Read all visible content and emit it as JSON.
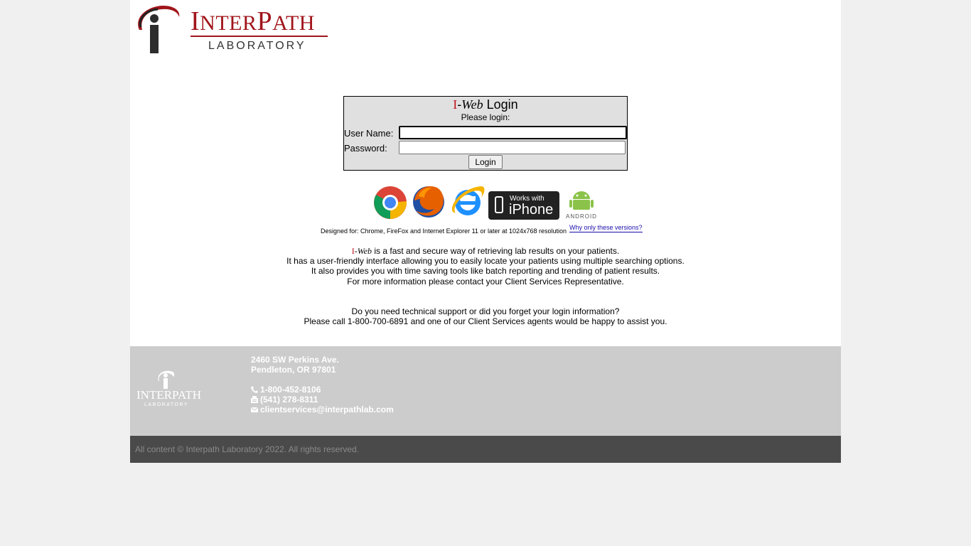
{
  "brand": {
    "name_first": "I",
    "name_rest": "NTER",
    "name_second_first": "P",
    "name_second_rest": "ATH",
    "subtitle": "LABORATORY",
    "colors": {
      "red": "#a0151b",
      "dark": "#333333"
    }
  },
  "login": {
    "title_i": "I",
    "title_dash": "-",
    "title_web": "Web",
    "title_login": " Login",
    "please": "Please login:",
    "username_label": "User Name:",
    "username_value": "",
    "password_label": "Password:",
    "password_value": "",
    "button_label": "Login"
  },
  "browsers": {
    "icons": [
      "chrome-icon",
      "firefox-icon",
      "internet-explorer-icon",
      "works-with-iphone-badge",
      "android-icon"
    ],
    "iphone_badge_top": "Works with",
    "iphone_badge_main": "iPhone",
    "android_label": "ANDROID",
    "designed_for": "Designed for: Chrome, FireFox and Internet Explorer 11 or later at 1024x768 resolution",
    "why_link": "Why only these versions?"
  },
  "info": {
    "iweb_i": "I",
    "iweb_dash": "-",
    "iweb_web": "Web",
    "line1_rest": " is a fast and secure way of retrieving lab results on your patients.",
    "line2": "It has a user-friendly interface allowing you to easily locate your patients using multiple searching options.",
    "line3": "It also provides you with time saving tools like batch reporting and trending of patient results.",
    "line4": "For more information please contact your Client Services Representative.",
    "support1": "Do you need technical support or did you forget your login information?",
    "support2": "Please call 1-800-700-6891 and one of our Client Services agents would be happy to assist you."
  },
  "footer": {
    "logo_word": "INTERPATH",
    "logo_sub": "LABORATORY",
    "address1": "2460 SW Perkins Ave.",
    "address2": "Pendleton, OR 97801",
    "phone": "1-800-452-8106",
    "fax": "(541) 278-8311",
    "email": "clientservices@interpathlab.com",
    "copyright": "All content © Interpath Laboratory 2022. All rights reserved."
  }
}
